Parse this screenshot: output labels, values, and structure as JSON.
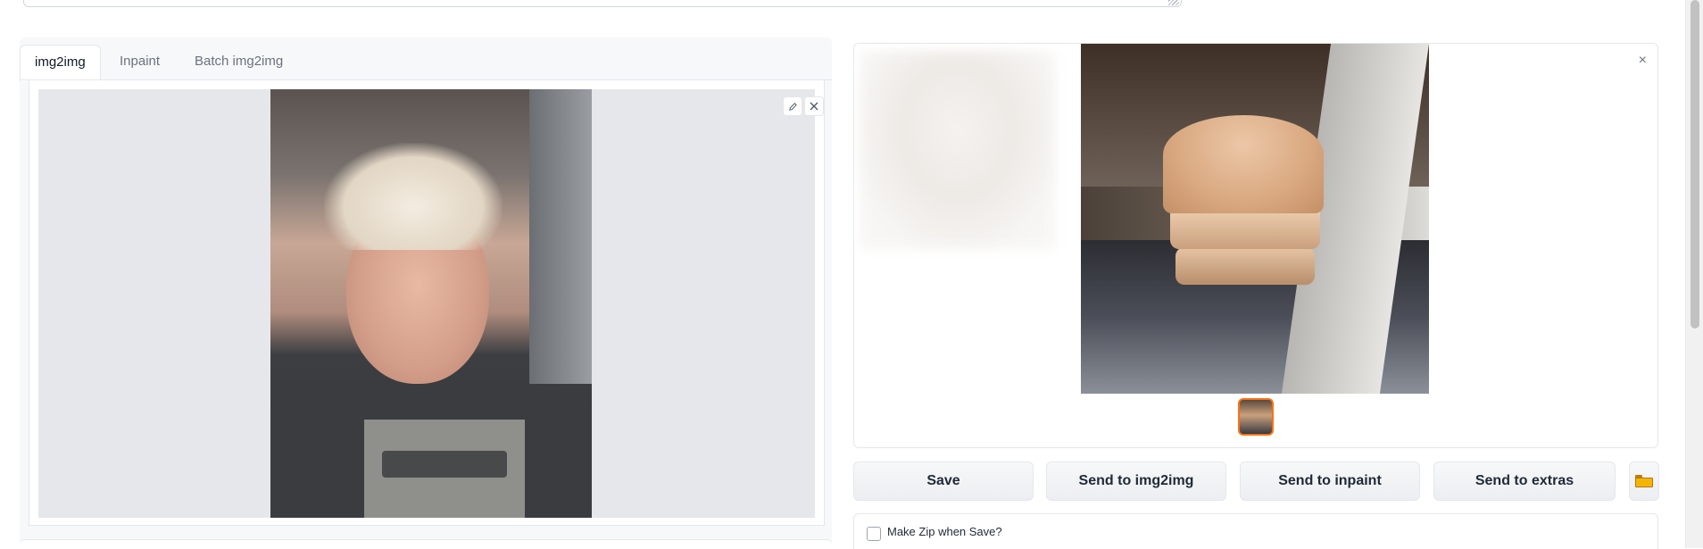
{
  "prompt_area": {
    "value": ""
  },
  "tabs": [
    {
      "label": "img2img",
      "active": true
    },
    {
      "label": "Inpaint",
      "active": false
    },
    {
      "label": "Batch img2img",
      "active": false
    }
  ],
  "input_image": {
    "description_icon_edit": "pencil-icon",
    "description_icon_close": "close-icon"
  },
  "output": {
    "close_glyph": "×",
    "thumbnails_count": 1
  },
  "actions": {
    "save": "Save",
    "send_img2img": "Send to img2img",
    "send_inpaint": "Send to inpaint",
    "send_extras": "Send to extras",
    "folder_icon": "folder-icon"
  },
  "zip": {
    "label": "Make Zip when Save?",
    "checked": false
  },
  "colors": {
    "accent": "#f97316",
    "panel_bg": "#f7f8fa",
    "border": "#e5e7eb"
  }
}
